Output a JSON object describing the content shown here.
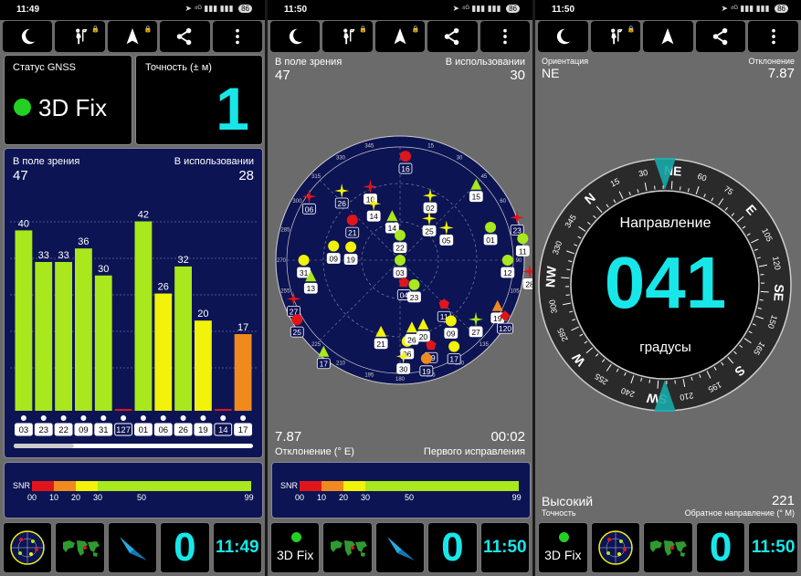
{
  "colors": {
    "accent": "#18e7ea",
    "navy": "#0d1454",
    "bar_green": "#a8e81c",
    "bar_yellow": "#f2f20a",
    "bar_orange": "#f08a1e",
    "bar_red": "#e0151a"
  },
  "toolbar_icons": [
    "moon-icon",
    "walker-icon",
    "navigation-arrow-icon",
    "share-icon",
    "more-vertical-icon"
  ],
  "screen1": {
    "status_time": "11:49",
    "battery": "86",
    "gnss_status_label": "Статус GNSS",
    "fix_text": "3D Fix",
    "accuracy_label": "Точность (± м)",
    "accuracy_value": "1",
    "in_view_label": "В поле зрения",
    "in_view_value": "47",
    "in_use_label": "В использовании",
    "in_use_value": "28",
    "chart_data": {
      "type": "bar",
      "title": "",
      "categories": [
        "03",
        "23",
        "22",
        "09",
        "31",
        "127",
        "01",
        "06",
        "26",
        "19",
        "14",
        "17"
      ],
      "values": [
        40,
        33,
        33,
        36,
        30,
        0,
        42,
        26,
        32,
        20,
        0,
        17
      ],
      "value_labels": [
        "40",
        "33",
        "33",
        "36",
        "30",
        "",
        "42",
        "26",
        "32",
        "20",
        "",
        "17"
      ],
      "bar_colors": [
        "#a8e81c",
        "#a8e81c",
        "#a8e81c",
        "#a8e81c",
        "#a8e81c",
        "#e0151a",
        "#a8e81c",
        "#f2f20a",
        "#a8e81c",
        "#f2f20a",
        "#e0151a",
        "#f08a1e"
      ],
      "boxed_labels": [
        "127",
        "14"
      ],
      "ylim": [
        0,
        50
      ]
    },
    "snr_label": "SNR",
    "snr_ticks": [
      "00",
      "10",
      "20",
      "30",
      "50",
      "99"
    ],
    "bottom_clock": "11:49",
    "bottom_count": "0"
  },
  "screen2": {
    "status_time": "11:50",
    "battery": "86",
    "in_view_label": "В поле зрения",
    "in_view_value": "47",
    "in_use_label": "В использовании",
    "in_use_value": "30",
    "sky_ring_labels": [
      "105",
      "120",
      "135",
      "150",
      "165",
      "180",
      "195",
      "210",
      "225",
      "240",
      "255",
      "270",
      "285",
      "300",
      "315",
      "330",
      "345",
      "15",
      "30",
      "45",
      "60",
      "75",
      "90"
    ],
    "satellites": [
      {
        "id": "16",
        "az": 3,
        "el": 0.92,
        "shape": "circle",
        "color": "#e0151a",
        "boxed": true
      },
      {
        "id": "02",
        "az": 25,
        "el": 0.63,
        "shape": "star",
        "color": "#f2f20a",
        "boxed": false
      },
      {
        "id": "10",
        "az": -22,
        "el": 0.7,
        "shape": "star",
        "color": "#e0151a",
        "boxed": false
      },
      {
        "id": "14",
        "az": -25,
        "el": 0.55,
        "shape": "star",
        "color": "#f2f20a",
        "boxed": false
      },
      {
        "id": "26",
        "az": -40,
        "el": 0.8,
        "shape": "star",
        "color": "#f2f20a",
        "boxed": true
      },
      {
        "id": "05",
        "az": 55,
        "el": 0.5,
        "shape": "star",
        "color": "#f2f20a",
        "boxed": false
      },
      {
        "id": "15",
        "az": 45,
        "el": 0.95,
        "shape": "triangle",
        "color": "#a8e81c",
        "boxed": false
      },
      {
        "id": "06",
        "az": -55,
        "el": 0.98,
        "shape": "star",
        "color": "#e0151a",
        "boxed": true
      },
      {
        "id": "21",
        "az": -50,
        "el": 0.55,
        "shape": "circle",
        "color": "#e0151a",
        "boxed": true
      },
      {
        "id": "14",
        "az": -10,
        "el": 0.4,
        "shape": "triangle",
        "color": "#a8e81c",
        "boxed": false
      },
      {
        "id": "25",
        "az": 35,
        "el": 0.45,
        "shape": "star",
        "color": "#f2f20a",
        "boxed": false
      },
      {
        "id": "19",
        "az": -75,
        "el": 0.45,
        "shape": "circle",
        "color": "#f2f20a",
        "boxed": false
      },
      {
        "id": "09",
        "az": -78,
        "el": 0.6,
        "shape": "circle",
        "color": "#f2f20a",
        "boxed": false
      },
      {
        "id": "22",
        "az": 0,
        "el": 0.22,
        "shape": "circle",
        "color": "#a8e81c",
        "boxed": false
      },
      {
        "id": "01",
        "az": 70,
        "el": 0.85,
        "shape": "circle",
        "color": "#a8e81c",
        "boxed": false
      },
      {
        "id": "23",
        "az": 70,
        "el": 1.1,
        "shape": "star",
        "color": "#e0151a",
        "boxed": true
      },
      {
        "id": "11",
        "az": 80,
        "el": 1.1,
        "shape": "circle",
        "color": "#a8e81c",
        "boxed": false
      },
      {
        "id": "12",
        "az": 90,
        "el": 0.95,
        "shape": "circle",
        "color": "#a8e81c",
        "boxed": false
      },
      {
        "id": "28",
        "az": 95,
        "el": 1.2,
        "shape": "star",
        "color": "#e0151a",
        "boxed": false
      },
      {
        "id": "31",
        "az": -90,
        "el": 0.85,
        "shape": "circle",
        "color": "#f2f20a",
        "boxed": false
      },
      {
        "id": "13",
        "az": -100,
        "el": 0.8,
        "shape": "triangle",
        "color": "#a8e81c",
        "boxed": false
      },
      {
        "id": "03",
        "az": 0,
        "el": 0.0,
        "shape": "circle",
        "color": "#a8e81c",
        "boxed": false
      },
      {
        "id": "27",
        "az": -110,
        "el": 1.0,
        "shape": "star",
        "color": "#e0151a",
        "boxed": true
      },
      {
        "id": "19",
        "az": 115,
        "el": 0.95,
        "shape": "triangle",
        "color": "#f08a1e",
        "boxed": false
      },
      {
        "id": "04",
        "az": 170,
        "el": 0.2,
        "shape": "pentagon",
        "color": "#e0151a",
        "boxed": true
      },
      {
        "id": "23",
        "az": 150,
        "el": 0.25,
        "shape": "circle",
        "color": "#a8e81c",
        "boxed": false
      },
      {
        "id": "25",
        "az": -120,
        "el": 1.05,
        "shape": "circle",
        "color": "#e0151a",
        "boxed": true
      },
      {
        "id": "11",
        "az": 135,
        "el": 0.55,
        "shape": "pentagon",
        "color": "#e0151a",
        "boxed": true
      },
      {
        "id": "09",
        "az": 140,
        "el": 0.7,
        "shape": "circle",
        "color": "#f2f20a",
        "boxed": false
      },
      {
        "id": "27",
        "az": 128,
        "el": 0.85,
        "shape": "star",
        "color": "#a8e81c",
        "boxed": false
      },
      {
        "id": "120",
        "az": 118,
        "el": 1.05,
        "shape": "diamond",
        "color": "#e0151a",
        "boxed": true
      },
      {
        "id": "17",
        "az": -140,
        "el": 1.05,
        "shape": "triangle",
        "color": "#a8e81c",
        "boxed": true
      },
      {
        "id": "21",
        "az": -165,
        "el": 0.65,
        "shape": "triangle",
        "color": "#f2f20a",
        "boxed": false
      },
      {
        "id": "06",
        "az": 175,
        "el": 0.72,
        "shape": "circle",
        "color": "#f2f20a",
        "boxed": false
      },
      {
        "id": "20",
        "az": 160,
        "el": 0.6,
        "shape": "triangle",
        "color": "#f2f20a",
        "boxed": false
      },
      {
        "id": "26",
        "az": 170,
        "el": 0.6,
        "shape": "triangle",
        "color": "#f2f20a",
        "boxed": false
      },
      {
        "id": "30",
        "az": 178,
        "el": 0.85,
        "shape": "star",
        "color": "#f2f20a",
        "boxed": false
      },
      {
        "id": "09",
        "az": 160,
        "el": 0.8,
        "shape": "pentagon",
        "color": "#e0151a",
        "boxed": true
      },
      {
        "id": "19",
        "az": 165,
        "el": 0.9,
        "shape": "circle",
        "color": "#f08a1e",
        "boxed": true
      },
      {
        "id": "17",
        "az": 148,
        "el": 0.9,
        "shape": "circle",
        "color": "#f2f20a",
        "boxed": true
      }
    ],
    "deviation_value": "7.87",
    "deviation_label": "Отклонение (° E)",
    "ttff_value": "00:02",
    "ttff_label": "Первого исправления",
    "snr_label": "SNR",
    "snr_ticks": [
      "00",
      "10",
      "20",
      "30",
      "50",
      "99"
    ],
    "bottom_fix": "3D Fix",
    "bottom_count": "0",
    "bottom_clock": "11:50"
  },
  "screen3": {
    "status_time": "11:50",
    "battery": "86",
    "orientation_label": "Ориентация",
    "orientation_value": "NE",
    "deviation_label": "Отклонение",
    "deviation_value": "7.87",
    "direction_label": "Направление",
    "heading_value": "041",
    "units_label": "градусы",
    "compass_labels": [
      "NE",
      "60",
      "75",
      "E",
      "105",
      "120",
      "SE",
      "150",
      "165",
      "S",
      "195",
      "210",
      "SW",
      "240",
      "255",
      "W",
      "285",
      "300",
      "NW",
      "330",
      "345",
      "N",
      "15",
      "30"
    ],
    "accuracy_value": "Высокий",
    "accuracy_label": "Точность",
    "reverse_value": "221",
    "reverse_label": "Обратное направление (° M)",
    "bottom_fix": "3D Fix",
    "bottom_count": "0",
    "bottom_clock": "11:50"
  }
}
